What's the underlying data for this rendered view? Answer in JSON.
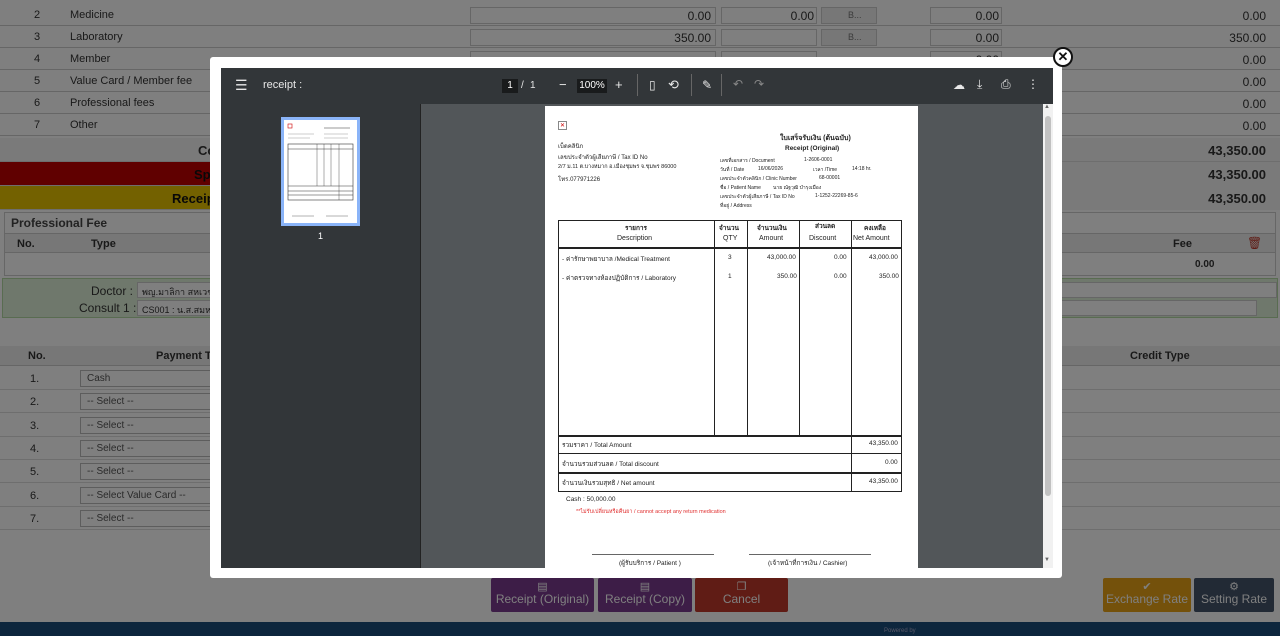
{
  "fee_rows": [
    {
      "no": "2",
      "name": "Medicine",
      "amount": "0.00",
      "c2": "0.00",
      "sel": "B...",
      "c4": "0.00",
      "net": "0.00"
    },
    {
      "no": "3",
      "name": "Laboratory",
      "amount": "350.00",
      "c2": "",
      "sel": "B...",
      "c4": "0.00",
      "net": "350.00"
    },
    {
      "no": "4",
      "name": "Member",
      "amount": "",
      "c2": "",
      "sel": "",
      "c4": "0.00",
      "net": "0.00"
    },
    {
      "no": "5",
      "name": "Value Card / Member fee",
      "amount": "",
      "c2": "",
      "sel": "",
      "c4": "0.00",
      "net": "0.00"
    },
    {
      "no": "6",
      "name": "Professional fees",
      "amount": "",
      "c2": "",
      "sel": "",
      "c4": "0.00",
      "net": "0.00"
    },
    {
      "no": "7",
      "name": "Other",
      "amount": "",
      "c2": "",
      "sel": "",
      "c4": "0.00",
      "net": "0.00"
    }
  ],
  "summary": [
    {
      "label": "Co",
      "value": "43,350.00"
    },
    {
      "label": "Spe",
      "value": "43,350.00"
    },
    {
      "label": "Receipt",
      "value": "43,350.00"
    }
  ],
  "prof_fee": {
    "title": "Professional Fee",
    "col_no": "No.",
    "col_type": "Type",
    "col_fee": "Fee",
    "fee_total": "0.00"
  },
  "doctor": {
    "label": "Doctor :",
    "value": "พญ.มาลิกา สหเวช",
    "consult_label": "Consult 1 :",
    "consult_value": "CS001 : น.ส.สมหญ"
  },
  "payment": {
    "col_no": "No.",
    "col_type": "Payment Ty",
    "col_credit": "Credit Type",
    "rows": [
      {
        "no": "1.",
        "sel": "Cash"
      },
      {
        "no": "2.",
        "sel": "-- Select --"
      },
      {
        "no": "3.",
        "sel": "-- Select --"
      },
      {
        "no": "4.",
        "sel": "-- Select --"
      },
      {
        "no": "5.",
        "sel": "-- Select --"
      },
      {
        "no": "6.",
        "sel": "-- Select Value Card --"
      },
      {
        "no": "7.",
        "sel": "-- Select --"
      }
    ]
  },
  "buttons": {
    "receipt_original": "Receipt (Original)",
    "receipt_copy": "Receipt (Copy)",
    "cancel": "Cancel",
    "exchange_rate": "Exchange Rate",
    "setting_rate": "Setting Rate",
    "powered": "Powered by"
  },
  "viewer": {
    "title": "receipt :",
    "page_current": "1",
    "page_sep": "/",
    "page_total": "1",
    "zoom": "100%",
    "thumb_label": "1"
  },
  "receipt": {
    "clinic": "เบ็ดคลินิก",
    "tax_label": "เลขประจำตัวผู้เสียภาษี / Tax ID No",
    "address": "2/7 ม.11 ต.บางหมาก อ.เมืองชุมพร จ.ชุมพร 86000",
    "tel": "โทร.077971226",
    "title_th": "ใบเสร็จรับเงิน (ต้นฉบับ)",
    "title_en": "Receipt (Original)",
    "doc_label": "เลขที่เอกสาร / Document",
    "doc_value": "1-2606-0001",
    "date_label": "วันที่ / Date",
    "date_value": "16/06/2026",
    "time_label": "เวลา /Time",
    "time_value": "14:18 hr.",
    "clinic_no_label": "เลขประจำตัวคลินิก / Clinic Number",
    "clinic_no_value": "68-00001",
    "patient_label": "ชื่อ / Patient Name",
    "patient_value": "นาย ณัฐวุฒิ บำรุงเมือง",
    "ptax_label": "เลขประจำตัวผู้เสียภาษี / Tax ID No",
    "ptax_value": "1-1252-22269-85-6",
    "addr_label": "ที่อยู่ / Address",
    "h_desc_th": "รายการ",
    "h_desc": "Description",
    "h_qty_th": "จำนวน",
    "h_qty": "QTY",
    "h_amt_th": "จำนวนเงิน",
    "h_amt": "Amount",
    "h_disc_th": "ส่วนลด",
    "h_disc": "Discount",
    "h_net_th": "คงเหลือ",
    "h_net": "Net Amount",
    "items": [
      {
        "desc": "- ค่ารักษาพยาบาล /Medical Treatment",
        "qty": "3",
        "amt": "43,000.00",
        "disc": "0.00",
        "net": "43,000.00"
      },
      {
        "desc": "- ค่าตรวจทางห้องปฏิบัติการ / Laboratory",
        "qty": "1",
        "amt": "350.00",
        "disc": "0.00",
        "net": "350.00"
      }
    ],
    "total_label": "รวมราคา / Total Amount",
    "total_value": "43,350.00",
    "discount_label": "จำนวนรวมส่วนลด / Total discount",
    "discount_value": "0.00",
    "net_label": "จำนวนเงินรวมสุทธิ / Net amount",
    "net_value": "43,350.00",
    "cash": "Cash : 50,000.00",
    "note": "**ไม่รับเปลี่ยนหรือคืนยา / cannot accept any return medication",
    "sign_patient": "(ผู้รับบริการ / Patient )",
    "sign_cashier": "(เจ้าหน้าที่การเงิน / Cashier)",
    "logo_x": "✕"
  },
  "colors": {
    "red_row": "#c00000",
    "yellow_row": "#e6c200",
    "purple": "#7a3b8f",
    "cancel": "#c0392b",
    "orange": "#e8a317",
    "slate": "#44546a"
  }
}
